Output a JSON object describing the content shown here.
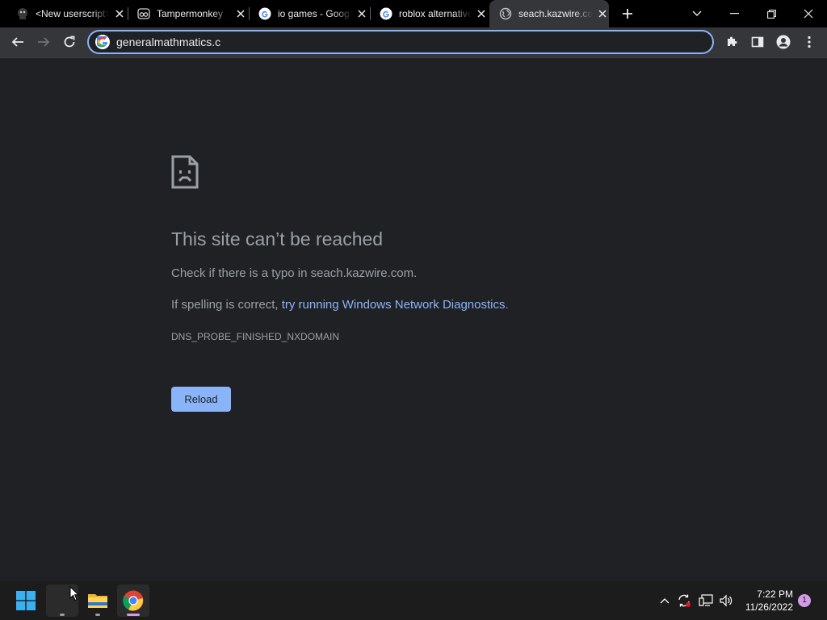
{
  "tabs": [
    {
      "title": "<New userscript>",
      "icon": "userscript-icon"
    },
    {
      "title": "Tampermonkey",
      "icon": "tampermonkey-icon"
    },
    {
      "title": "io games - Google Search",
      "icon": "google-icon"
    },
    {
      "title": "roblox alternative",
      "icon": "google-icon"
    },
    {
      "title": "seach.kazwire.com",
      "icon": "globe-icon",
      "active": true
    }
  ],
  "omnibox": {
    "value": "generalmathmatics.c"
  },
  "error_page": {
    "heading": "This site can’t be reached",
    "typo_text": "Check if there is a typo in seach.kazwire.com.",
    "spelling_prefix": "If spelling is correct, ",
    "diagnostics_link": "try running Windows Network Diagnostics",
    "spelling_suffix": ".",
    "error_code": "DNS_PROBE_FINISHED_NXDOMAIN",
    "reload_label": "Reload"
  },
  "taskbar": {
    "time": "7:22 PM",
    "date": "11/26/2022",
    "notification_count": "1"
  },
  "colors": {
    "page_bg": "#202124",
    "accent": "#8ab4f8",
    "text": "#9aa0a6",
    "tab_strip": "#000000",
    "toolbar": "#35363a"
  }
}
